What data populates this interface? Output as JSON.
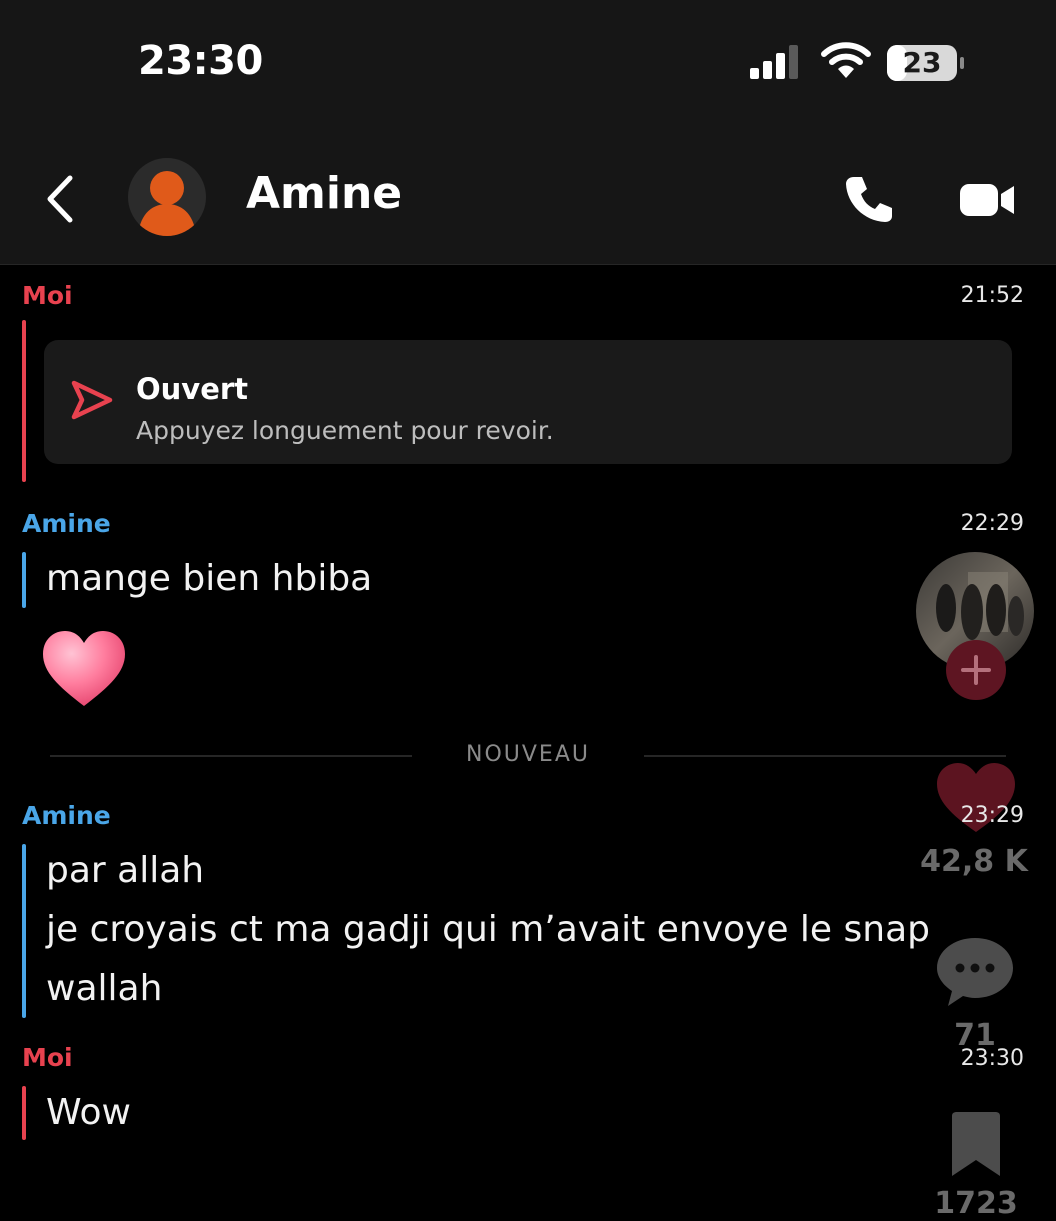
{
  "status_bar": {
    "time": "23:30",
    "battery": "23"
  },
  "header": {
    "contact_name": "Amine"
  },
  "messages": [
    {
      "sender": "Moi",
      "time": "21:52",
      "type": "snap",
      "title": "Ouvert",
      "subtitle": "Appuyez longuement pour revoir."
    },
    {
      "sender": "Amine",
      "time": "22:29",
      "type": "text",
      "lines": [
        "mange bien hbiba"
      ],
      "emoji": "heart-emoji"
    },
    {
      "sender": "Amine",
      "time": "23:29",
      "type": "text",
      "lines": [
        "par allah",
        "je croyais ct ma gadji qui m’avait envoye le snap",
        "wallah"
      ]
    },
    {
      "sender": "Moi",
      "time": "23:30",
      "type": "text",
      "lines": [
        "Wow"
      ]
    }
  ],
  "divider": {
    "label": "NOUVEAU"
  },
  "overlay": {
    "likes": "42,8 K",
    "comments": "71",
    "bookmarks": "1723"
  },
  "colors": {
    "me": "#e8424f",
    "amine": "#4aa6e8",
    "background": "#000000",
    "header": "#161616"
  },
  "icons": [
    "back-chevron-icon",
    "avatar-icon",
    "phone-icon",
    "video-camera-icon",
    "snap-sent-arrow-icon",
    "heart-icon",
    "comment-icon",
    "bookmark-icon",
    "plus-icon"
  ]
}
